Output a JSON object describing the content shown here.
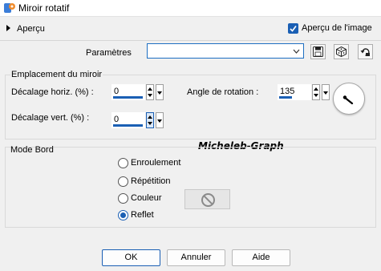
{
  "window": {
    "title": "Miroir rotatif"
  },
  "preview": {
    "label": "Aperçu",
    "image_preview_label": "Aperçu de l'image",
    "image_preview_checked": true
  },
  "params": {
    "label": "Paramètres",
    "value": ""
  },
  "mirror_group": {
    "title": "Emplacement du miroir",
    "hshift_label": "Décalage horiz. (%) :",
    "hshift_value": "0",
    "vshift_label": "Décalage vert. (%) :",
    "vshift_value": "0",
    "angle_label": "Angle de rotation :",
    "angle_value": "135"
  },
  "watermark": "Micheleb-Graph",
  "edge_group": {
    "title": "Mode Bord",
    "options": [
      "Enroulement",
      "Répétition",
      "Couleur",
      "Reflet"
    ],
    "selected": "Reflet"
  },
  "buttons": {
    "ok": "OK",
    "cancel": "Annuler",
    "help": "Aide"
  },
  "colors": {
    "accent": "#1a5fb4",
    "background": "#f0f0f0"
  },
  "icons": {
    "app": "app-icon",
    "save": "save-icon",
    "random": "dice-icon",
    "reset": "reset-icon",
    "dial": "angle-dial-icon",
    "no_color": "no-color-icon"
  }
}
